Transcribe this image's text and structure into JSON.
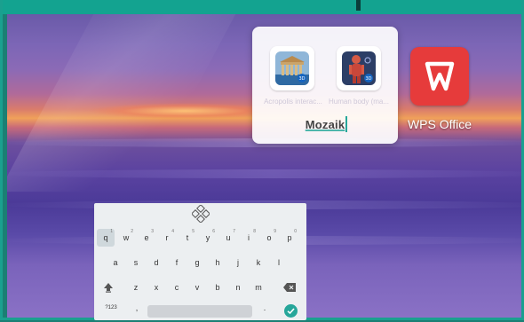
{
  "folder": {
    "name": "Mozaik",
    "apps": [
      {
        "label": "Acropolis interac...",
        "icon": "acropolis-icon"
      },
      {
        "label": "Human body (ma...",
        "icon": "human-body-icon"
      }
    ]
  },
  "desktop": {
    "apps": [
      {
        "label": "WPS Office",
        "icon": "wps-office-icon"
      }
    ]
  },
  "keyboard": {
    "row1": [
      {
        "k": "q",
        "s": "1"
      },
      {
        "k": "w",
        "s": "2"
      },
      {
        "k": "e",
        "s": "3"
      },
      {
        "k": "r",
        "s": "4"
      },
      {
        "k": "t",
        "s": "5"
      },
      {
        "k": "y",
        "s": "6"
      },
      {
        "k": "u",
        "s": "7"
      },
      {
        "k": "i",
        "s": "8"
      },
      {
        "k": "o",
        "s": "9"
      },
      {
        "k": "p",
        "s": "0"
      }
    ],
    "row2": [
      "a",
      "s",
      "d",
      "f",
      "g",
      "h",
      "j",
      "k",
      "l"
    ],
    "row3": [
      "z",
      "x",
      "c",
      "v",
      "b",
      "n",
      "m"
    ],
    "row4": {
      "symbols": "?123",
      "comma": ",",
      "period": "."
    }
  },
  "colors": {
    "accent": "#26a69a",
    "wps_red": "#e63b3b",
    "frame": "#1aa08f"
  }
}
